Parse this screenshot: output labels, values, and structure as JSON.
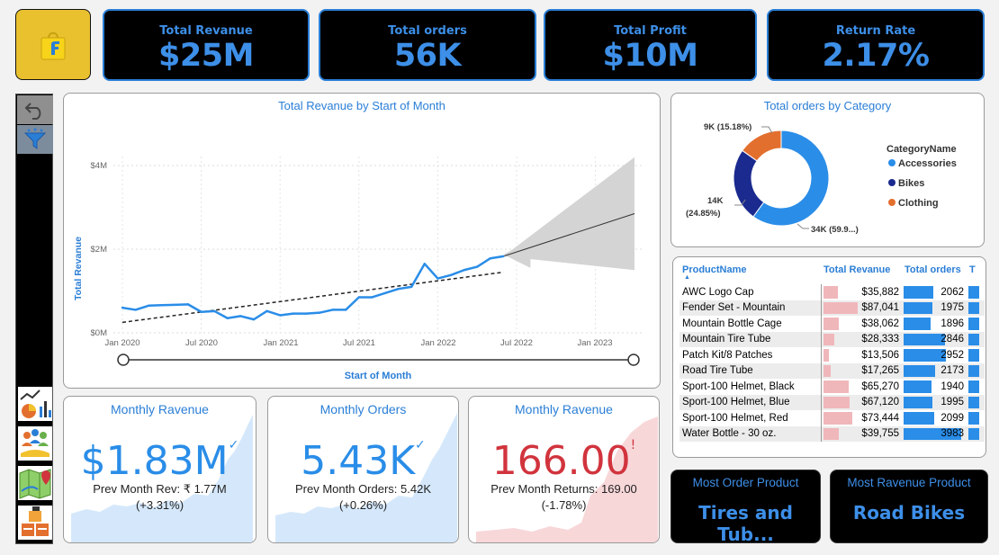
{
  "kpis": [
    {
      "title": "Total Revanue",
      "value": "$25M"
    },
    {
      "title": "Total orders",
      "value": "56K"
    },
    {
      "title": "Total Profit",
      "value": "$10M"
    },
    {
      "title": "Return Rate",
      "value": "2.17%"
    }
  ],
  "line_chart": {
    "title": "Total Revanue by Start of Month",
    "ylabel": "Total Revanue",
    "xlabel": "Start of Month",
    "y_ticks": [
      "$4M",
      "$2M",
      "$0M"
    ],
    "x_ticks": [
      "Jan 2020",
      "Jul 2020",
      "Jan 2021",
      "Jul 2021",
      "Jan 2022",
      "Jul 2022",
      "Jan 2023"
    ]
  },
  "donut": {
    "title": "Total orders by Category",
    "legend_title": "CategoryName",
    "labels": {
      "clothing": "9K (15.18%)",
      "bikes_1": "14K",
      "bikes_2": "(24.85%)",
      "accessories": "34K (59.9...)"
    }
  },
  "table": {
    "headers": [
      "ProductName",
      "Total Revanue",
      "Total orders",
      "T"
    ],
    "rows": [
      {
        "name": "AWC Logo Cap",
        "rev": "$35,882",
        "orders": "2062"
      },
      {
        "name": "Fender Set - Mountain",
        "rev": "$87,041",
        "orders": "1975"
      },
      {
        "name": "Mountain Bottle Cage",
        "rev": "$38,062",
        "orders": "1896"
      },
      {
        "name": "Mountain Tire Tube",
        "rev": "$28,333",
        "orders": "2846"
      },
      {
        "name": "Patch Kit/8 Patches",
        "rev": "$13,506",
        "orders": "2952"
      },
      {
        "name": "Road Tire Tube",
        "rev": "$17,265",
        "orders": "2173"
      },
      {
        "name": "Sport-100 Helmet, Black",
        "rev": "$65,270",
        "orders": "1940"
      },
      {
        "name": "Sport-100 Helmet, Blue",
        "rev": "$67,120",
        "orders": "1995"
      },
      {
        "name": "Sport-100 Helmet, Red",
        "rev": "$73,444",
        "orders": "2099"
      },
      {
        "name": "Water Bottle - 30 oz.",
        "rev": "$39,755",
        "orders": "3983"
      }
    ]
  },
  "cards": [
    {
      "title": "Monthly Ravenue",
      "value": "$1.83M",
      "sub1": "Prev Month Rev: ₹ 1.77M",
      "sub2": "(+3.31%)",
      "color": "#2a8de8"
    },
    {
      "title": "Monthly Orders",
      "value": "5.43K",
      "sub1": "Prev Month Orders: 5.42K",
      "sub2": "(+0.26%)",
      "color": "#2a8de8"
    },
    {
      "title": "Monthly Ravenue",
      "value": "166.00",
      "sub1": "Prev Month Returns: 169.00",
      "sub2": "(-1.78%)",
      "color": "#d1343d"
    }
  ],
  "bottom_cards": [
    {
      "title": "Most Order Product",
      "value": "Tires and Tub..."
    },
    {
      "title": "Most Ravenue Product",
      "value": "Road Bikes"
    }
  ],
  "colors": {
    "accent": "#2a7ed6",
    "bikes": "#1b2a8f",
    "clothing": "#e36f2e",
    "negative": "#d1343d"
  },
  "chart_data": [
    {
      "type": "line",
      "title": "Total Revanue by Start of Month",
      "xlabel": "Start of Month",
      "ylabel": "Total Revanue",
      "x": [
        "2020-01",
        "2020-02",
        "2020-03",
        "2020-04",
        "2020-05",
        "2020-06",
        "2020-07",
        "2020-08",
        "2020-09",
        "2020-10",
        "2020-11",
        "2020-12",
        "2021-01",
        "2021-02",
        "2021-03",
        "2021-04",
        "2021-05",
        "2021-06",
        "2021-07",
        "2021-08",
        "2021-09",
        "2021-10",
        "2021-11",
        "2021-12",
        "2022-01",
        "2022-02",
        "2022-03",
        "2022-04",
        "2022-05",
        "2022-06"
      ],
      "y": [
        0.6,
        0.55,
        0.65,
        0.66,
        0.67,
        0.68,
        0.5,
        0.52,
        0.35,
        0.4,
        0.32,
        0.52,
        0.42,
        0.46,
        0.46,
        0.48,
        0.55,
        0.55,
        0.85,
        0.85,
        0.95,
        1.05,
        1.1,
        1.65,
        1.3,
        1.38,
        1.5,
        1.58,
        1.78,
        1.83
      ],
      "ylim": [
        0,
        4.5
      ],
      "units": "$M"
    },
    {
      "type": "pie",
      "title": "Total orders by Category",
      "categories": [
        "Accessories",
        "Bikes",
        "Clothing"
      ],
      "values": [
        59.97,
        24.85,
        15.18
      ]
    }
  ]
}
